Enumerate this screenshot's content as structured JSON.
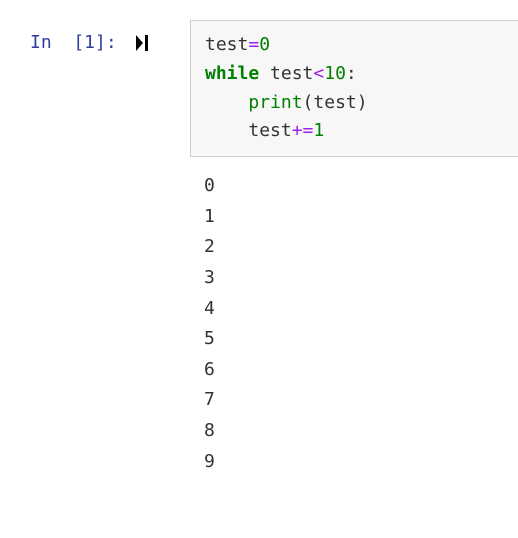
{
  "cell": {
    "prompt": "In  [1]:",
    "code": {
      "line1": {
        "var": "test",
        "op": "=",
        "val": "0"
      },
      "line2": {
        "kw": "while",
        "var": "test",
        "op": "<",
        "val": "10",
        "colon": ":"
      },
      "line3": {
        "indent": "    ",
        "func": "print",
        "lparen": "(",
        "arg": "test",
        "rparen": ")"
      },
      "line4": {
        "indent": "    ",
        "var": "test",
        "op": "+=",
        "val": "1"
      }
    }
  },
  "output_lines": [
    "0",
    "1",
    "2",
    "3",
    "4",
    "5",
    "6",
    "7",
    "8",
    "9"
  ]
}
